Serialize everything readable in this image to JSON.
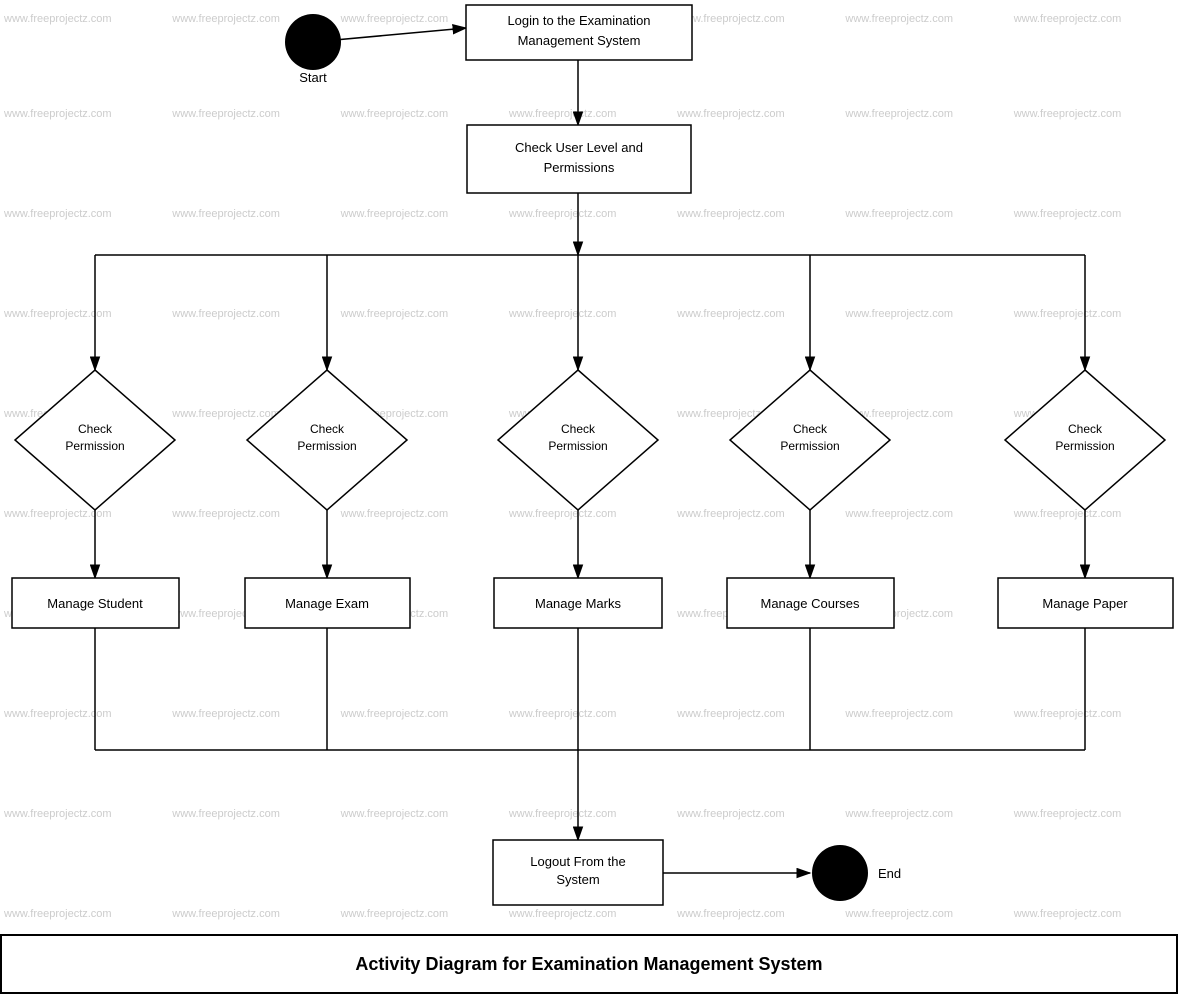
{
  "diagram": {
    "title": "Activity Diagram for Examination Management System",
    "nodes": {
      "start_label": "Start",
      "end_label": "End",
      "login": "Login to the Examination Management System",
      "check_permissions": "Check User Level and Permissions",
      "check_perm_1": "Check\nPermission",
      "check_perm_2": "Check\nPermission",
      "check_perm_3": "Check\nPermission",
      "check_perm_4": "Check\nPermission",
      "check_perm_5": "Check\nPermission",
      "manage_student": "Manage Student",
      "manage_exam": "Manage Exam",
      "manage_marks": "Manage Marks",
      "manage_courses": "Manage Courses",
      "manage_paper": "Manage Paper",
      "logout": "Logout From the System"
    },
    "watermark_text": "www.freeprojectz.com"
  }
}
